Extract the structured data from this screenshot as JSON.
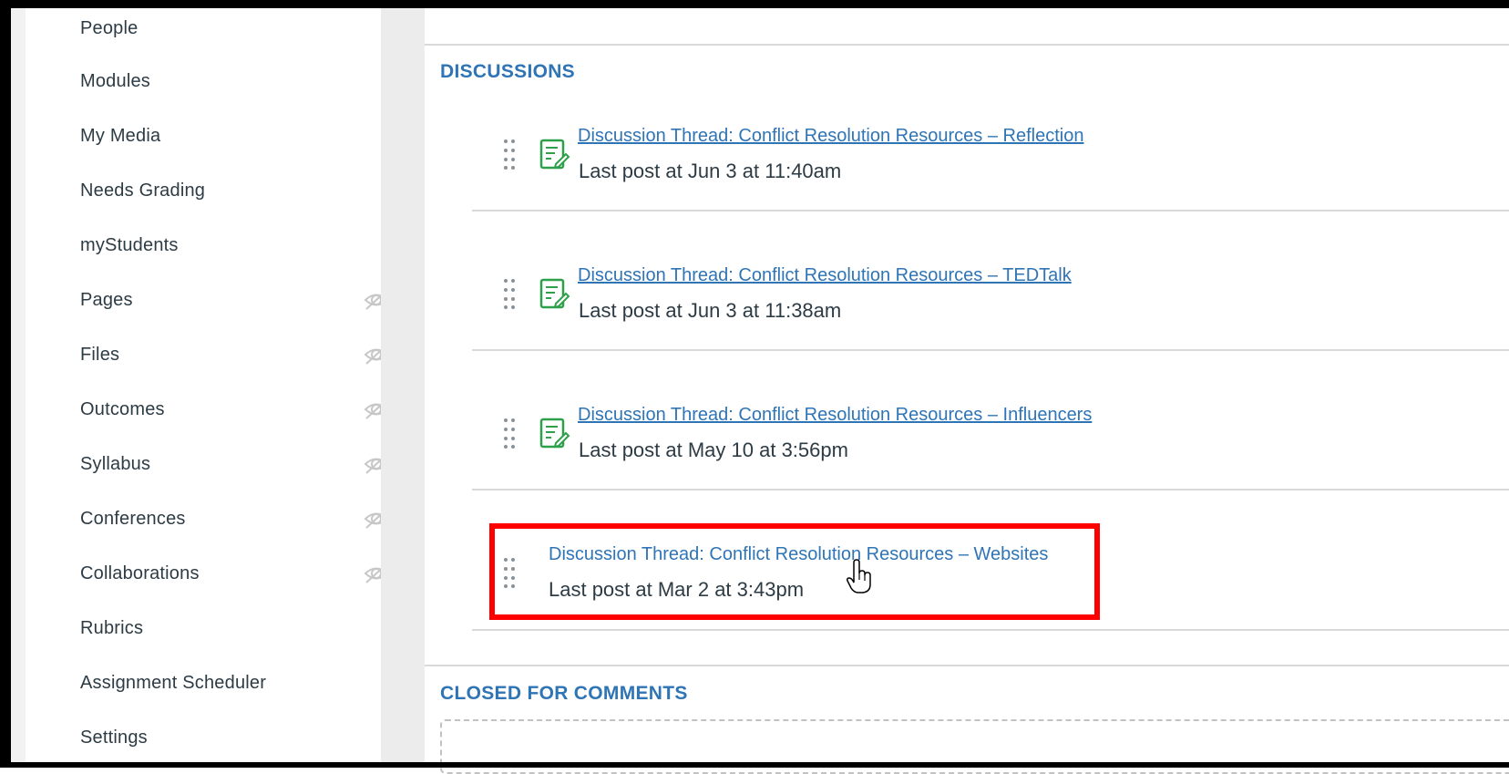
{
  "sidebar": {
    "items": [
      {
        "label": "People",
        "hidden": false
      },
      {
        "label": "Modules",
        "hidden": false
      },
      {
        "label": "My Media",
        "hidden": false
      },
      {
        "label": "Needs Grading",
        "hidden": false
      },
      {
        "label": "myStudents",
        "hidden": false
      },
      {
        "label": "Pages",
        "hidden": true
      },
      {
        "label": "Files",
        "hidden": true
      },
      {
        "label": "Outcomes",
        "hidden": true
      },
      {
        "label": "Syllabus",
        "hidden": true
      },
      {
        "label": "Conferences",
        "hidden": true
      },
      {
        "label": "Collaborations",
        "hidden": true
      },
      {
        "label": "Rubrics",
        "hidden": false
      },
      {
        "label": "Assignment Scheduler",
        "hidden": false
      },
      {
        "label": "Settings",
        "hidden": false
      }
    ],
    "hidden_icon": "eye-slash-icon"
  },
  "discussions": {
    "title": "DISCUSSIONS",
    "items": [
      {
        "title": "Discussion Thread: Conflict Resolution Resources – Reflection",
        "meta": "Last post at Jun 3 at 11:40am",
        "icon": "discussion-edit-icon"
      },
      {
        "title": "Discussion Thread: Conflict Resolution Resources – TEDTalk",
        "meta": "Last post at Jun 3 at 11:38am",
        "icon": "discussion-edit-icon"
      },
      {
        "title": "Discussion Thread: Conflict Resolution Resources – Influencers",
        "meta": "Last post at May 10 at 3:56pm",
        "icon": "discussion-edit-icon"
      },
      {
        "title": "Discussion Thread: Conflict Resolution Resources – Websites",
        "meta": "Last post at Mar 2 at 3:43pm",
        "icon": null
      }
    ]
  },
  "closed": {
    "title": "CLOSED FOR COMMENTS"
  },
  "colors": {
    "link": "#2f74b5",
    "icon_green": "#2e9f4a",
    "highlight": "#ff0000",
    "text": "#2d3b45"
  }
}
